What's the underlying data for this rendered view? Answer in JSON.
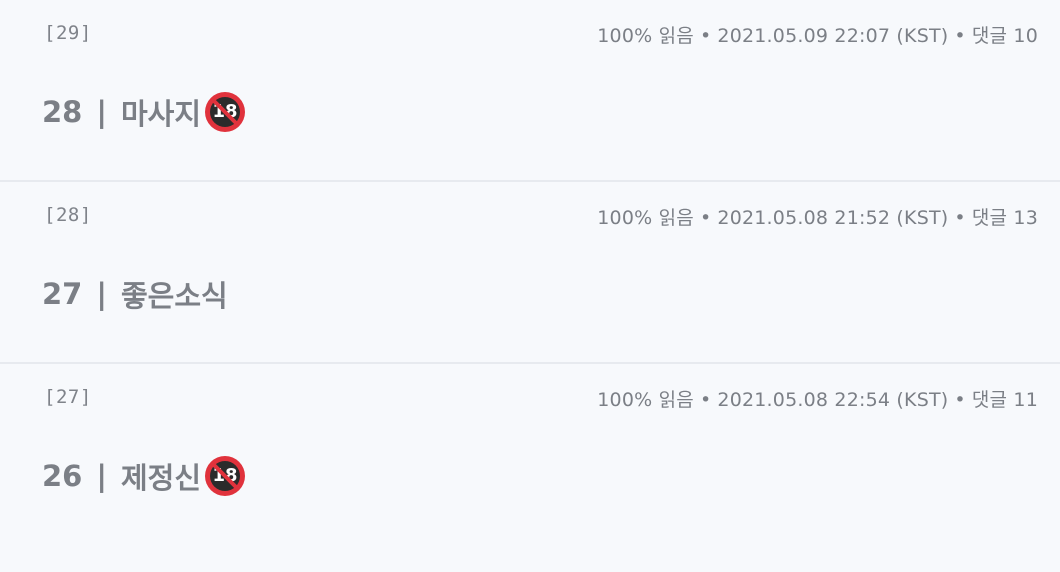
{
  "entries": [
    {
      "number": "[29]",
      "read": "100% 읽음",
      "datetime": "2021.05.09 22:07 (KST)",
      "comments": "댓글 10",
      "title_num": "28",
      "title_sep": "|",
      "title_text": "마사지",
      "badge": "18",
      "has_badge": true
    },
    {
      "number": "[28]",
      "read": "100% 읽음",
      "datetime": "2021.05.08 21:52 (KST)",
      "comments": "댓글 13",
      "title_num": "27",
      "title_sep": "|",
      "title_text": "좋은소식",
      "has_badge": false
    },
    {
      "number": "[27]",
      "read": "100% 읽음",
      "datetime": "2021.05.08 22:54 (KST)",
      "comments": "댓글 11",
      "title_num": "26",
      "title_sep": "|",
      "title_text": "제정신",
      "badge": "18",
      "has_badge": true
    }
  ],
  "meta_separator": "•",
  "colors": {
    "background": "#f7f9fc",
    "text": "#7b7f86",
    "divider": "#e7eaef",
    "badge_red": "#e0323c"
  },
  "icons": {
    "age_badge": "no-under-18-icon"
  }
}
